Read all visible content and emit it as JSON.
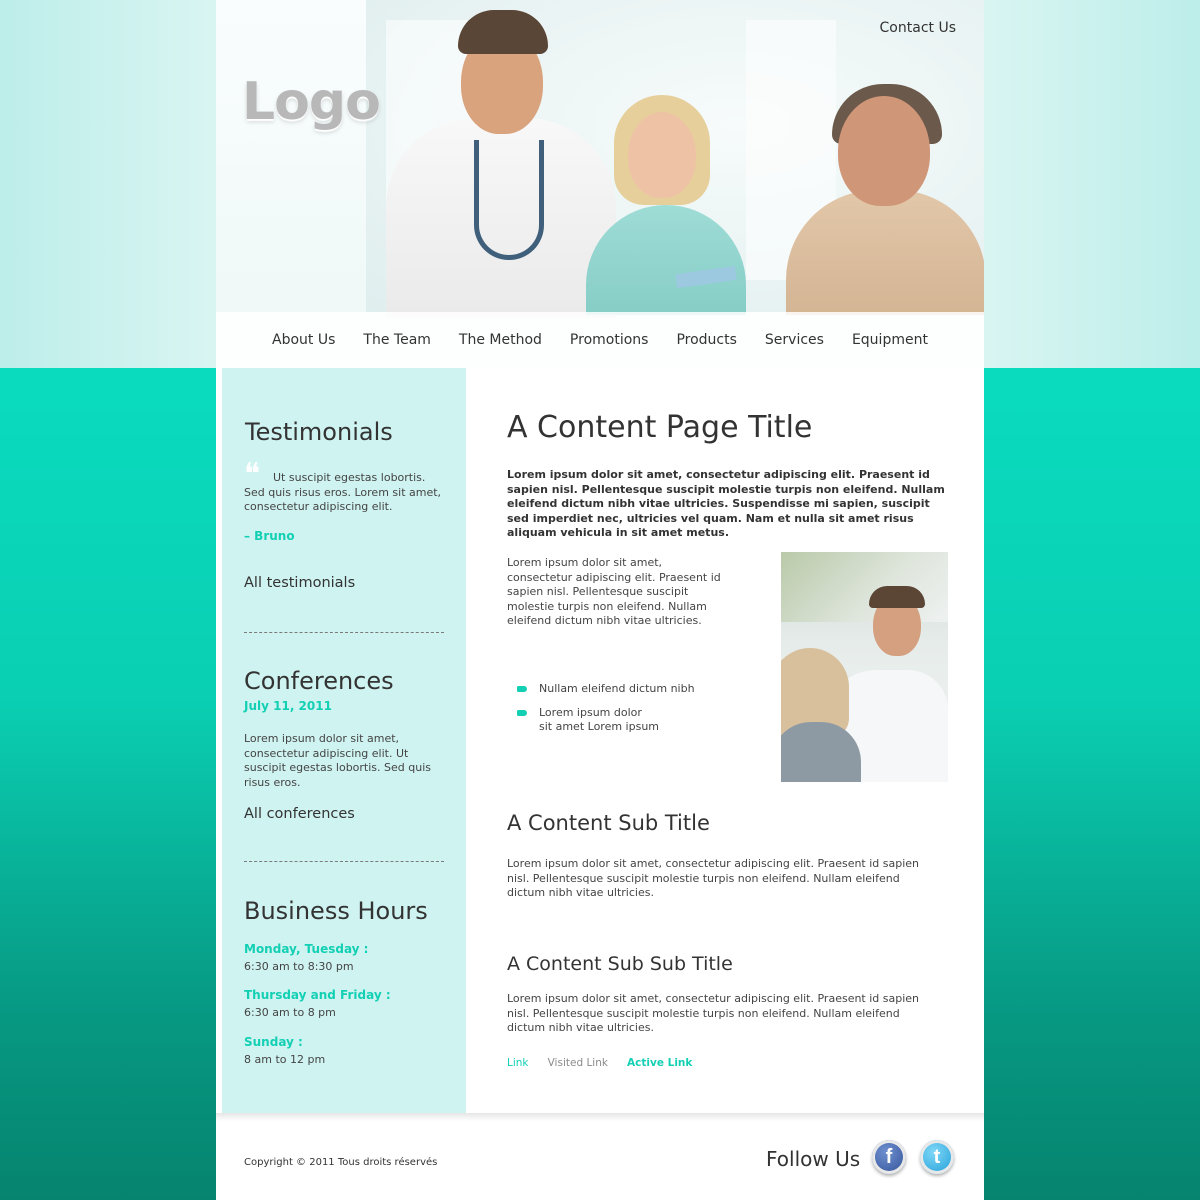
{
  "header": {
    "logo_text": "Logo",
    "contact_label": "Contact Us"
  },
  "nav": {
    "items": [
      "About Us",
      "The Team",
      "The Method",
      "Promotions",
      "Products",
      "Services",
      "Equipment"
    ]
  },
  "sidebar": {
    "testimonials": {
      "title": "Testimonials",
      "quote": "Ut suscipit egestas lobortis. Sed quis risus eros. Lorem sit amet, consectetur adipiscing elit.",
      "author": "– Bruno",
      "all_link": "All testimonials"
    },
    "conferences": {
      "title": "Conferences",
      "date": "July 11, 2011",
      "text": "Lorem ipsum dolor sit amet, consectetur adipiscing elit. Ut suscipit egestas lobortis. Sed quis risus eros.",
      "all_link": "All conferences"
    },
    "hours": {
      "title": "Business Hours",
      "entries": [
        {
          "days": "Monday, Tuesday :",
          "time": "6:30 am to 8:30 pm"
        },
        {
          "days": "Thursday and Friday :",
          "time": "6:30 am to 8 pm"
        },
        {
          "days": "Sunday :",
          "time": "8 am to 12 pm"
        }
      ]
    }
  },
  "main": {
    "title": "A Content Page Title",
    "lead": "Lorem ipsum dolor sit amet, consectetur adipiscing elit. Praesent id sapien nisl. Pellentesque suscipit molestie turpis non eleifend. Nullam eleifend dictum nibh vitae ultricies. Suspendisse mi sapien, suscipit sed imperdiet nec, ultricies vel quam. Nam et nulla sit amet risus aliquam vehicula in sit amet metus.",
    "intro": "Lorem ipsum dolor sit amet, consectetur adipiscing elit. Praesent id sapien nisl. Pellentesque suscipit molestie turpis non eleifend. Nullam eleifend dictum nibh vitae ultricies.",
    "bullets": [
      "Nullam eleifend dictum nibh",
      "Lorem ipsum dolor\nsit amet Lorem ipsum"
    ],
    "sub_title": "A Content Sub Title",
    "sub_text": "Lorem ipsum dolor sit amet, consectetur adipiscing elit. Praesent id sapien nisl. Pellentesque suscipit molestie turpis non eleifend. Nullam eleifend dictum nibh vitae ultricies.",
    "sub_sub_title": "A Content Sub Sub Title",
    "sub_sub_text": "Lorem ipsum dolor sit amet, consectetur adipiscing elit. Praesent id sapien nisl. Pellentesque suscipit molestie turpis non eleifend. Nullam eleifend dictum nibh vitae ultricies.",
    "links": {
      "link": "Link",
      "visited": "Visited Link",
      "active": "Active Link"
    }
  },
  "footer": {
    "copyright": "Copyright © 2011 Tous droits réservés",
    "follow_label": "Follow Us",
    "facebook_glyph": "f",
    "twitter_glyph": "t"
  },
  "colors": {
    "accent": "#13d0b4",
    "sidebar_bg": "#cff3f1",
    "page_bg_top": "#0adbbf",
    "page_bg_bottom": "#06846f",
    "link": "#13d0b4",
    "visited_link": "#8a8a8a",
    "active_link": "#13d0b4"
  }
}
